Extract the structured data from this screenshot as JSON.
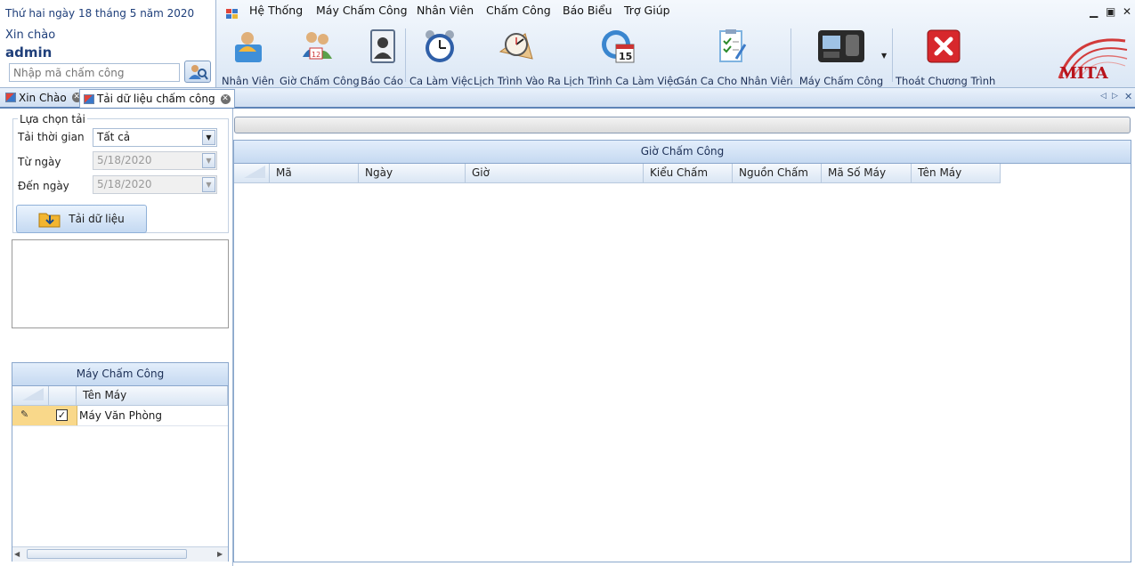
{
  "user": {
    "date": "Thứ hai ngày 18 tháng 5 năm 2020",
    "greeting": "Xin chào",
    "username": "admin",
    "code_placeholder": "Nhập mã chấm công"
  },
  "menu": [
    "Hệ Thống",
    "Máy Chấm Công",
    "Nhân Viên",
    "Chấm Công",
    "Báo Biểu",
    "Trợ Giúp"
  ],
  "toolbar": [
    {
      "label": "Nhân Viên",
      "icon": "employee-icon",
      "color": "#3f8fd8"
    },
    {
      "label": "Giờ Chấm Công",
      "icon": "attendance-time-icon",
      "color": "#2e6fb5"
    },
    {
      "label": "Báo Cáo",
      "icon": "report-icon",
      "color": "#5c6f8a"
    },
    {
      "label": "Ca Làm Việc",
      "icon": "alarm-clock-icon",
      "color": "#2f5fa8"
    },
    {
      "label": "Lịch Trình Vào Ra",
      "icon": "clock-schedule-icon",
      "color": "#d9a050"
    },
    {
      "label": "Lịch Trình Ca Làm Việc",
      "icon": "calendar-15-icon",
      "color": "#3a86cf"
    },
    {
      "label": "Gán Ca Cho Nhân Viên",
      "icon": "checklist-icon",
      "color": "#7fb3e0"
    },
    {
      "label": "Máy Chấm Công",
      "icon": "time-clock-device-icon",
      "color": "#2a2a2a"
    },
    {
      "label": "Thoát Chương Trình",
      "icon": "exit-x-icon",
      "color": "#d7282c"
    }
  ],
  "logo_text": "MITA",
  "tabs": [
    {
      "label": "Xin Chào"
    },
    {
      "label": "Tải dữ liệu chấm công"
    }
  ],
  "filter": {
    "group_title": "Lựa chọn tải",
    "period_label": "Tải thời gian",
    "period_value": "Tất cả",
    "from_label": "Từ ngày",
    "from_value": "5/18/2020",
    "to_label": "Đến ngày",
    "to_value": "5/18/2020",
    "load_button": "Tải dữ liệu"
  },
  "machines": {
    "title": "Máy Chấm Công",
    "column": "Tên Máy",
    "rows": [
      {
        "name": "Máy Văn Phòng",
        "checked": true
      }
    ]
  },
  "records": {
    "title": "Giờ Chấm Công",
    "columns": [
      "Mã",
      "Ngày",
      "Giờ",
      "Kiểu Chấm",
      "Nguồn Chấm",
      "Mã Số Máy",
      "Tên Máy"
    ]
  }
}
